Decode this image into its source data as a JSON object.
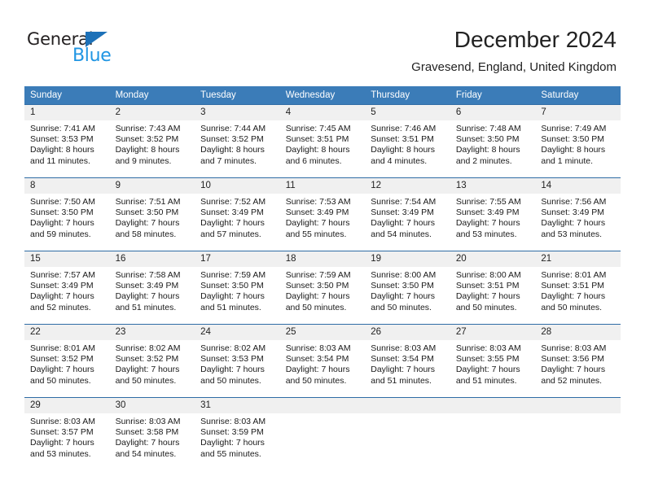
{
  "brand": {
    "name_top": "General",
    "name_bottom": "Blue",
    "accent_color": "#2196e3",
    "triangle_color": "#1d71b8"
  },
  "header": {
    "title": "December 2024",
    "subtitle": "Gravesend, England, United Kingdom"
  },
  "theme": {
    "header_bg": "#3b7cb8",
    "header_text": "#ffffff",
    "row_divider": "#2f6ca5",
    "daynum_bg": "#f0f0f0"
  },
  "weekdays": [
    "Sunday",
    "Monday",
    "Tuesday",
    "Wednesday",
    "Thursday",
    "Friday",
    "Saturday"
  ],
  "weeks": [
    [
      {
        "day": "1",
        "sunrise": "Sunrise: 7:41 AM",
        "sunset": "Sunset: 3:53 PM",
        "daylight1": "Daylight: 8 hours",
        "daylight2": "and 11 minutes."
      },
      {
        "day": "2",
        "sunrise": "Sunrise: 7:43 AM",
        "sunset": "Sunset: 3:52 PM",
        "daylight1": "Daylight: 8 hours",
        "daylight2": "and 9 minutes."
      },
      {
        "day": "3",
        "sunrise": "Sunrise: 7:44 AM",
        "sunset": "Sunset: 3:52 PM",
        "daylight1": "Daylight: 8 hours",
        "daylight2": "and 7 minutes."
      },
      {
        "day": "4",
        "sunrise": "Sunrise: 7:45 AM",
        "sunset": "Sunset: 3:51 PM",
        "daylight1": "Daylight: 8 hours",
        "daylight2": "and 6 minutes."
      },
      {
        "day": "5",
        "sunrise": "Sunrise: 7:46 AM",
        "sunset": "Sunset: 3:51 PM",
        "daylight1": "Daylight: 8 hours",
        "daylight2": "and 4 minutes."
      },
      {
        "day": "6",
        "sunrise": "Sunrise: 7:48 AM",
        "sunset": "Sunset: 3:50 PM",
        "daylight1": "Daylight: 8 hours",
        "daylight2": "and 2 minutes."
      },
      {
        "day": "7",
        "sunrise": "Sunrise: 7:49 AM",
        "sunset": "Sunset: 3:50 PM",
        "daylight1": "Daylight: 8 hours",
        "daylight2": "and 1 minute."
      }
    ],
    [
      {
        "day": "8",
        "sunrise": "Sunrise: 7:50 AM",
        "sunset": "Sunset: 3:50 PM",
        "daylight1": "Daylight: 7 hours",
        "daylight2": "and 59 minutes."
      },
      {
        "day": "9",
        "sunrise": "Sunrise: 7:51 AM",
        "sunset": "Sunset: 3:50 PM",
        "daylight1": "Daylight: 7 hours",
        "daylight2": "and 58 minutes."
      },
      {
        "day": "10",
        "sunrise": "Sunrise: 7:52 AM",
        "sunset": "Sunset: 3:49 PM",
        "daylight1": "Daylight: 7 hours",
        "daylight2": "and 57 minutes."
      },
      {
        "day": "11",
        "sunrise": "Sunrise: 7:53 AM",
        "sunset": "Sunset: 3:49 PM",
        "daylight1": "Daylight: 7 hours",
        "daylight2": "and 55 minutes."
      },
      {
        "day": "12",
        "sunrise": "Sunrise: 7:54 AM",
        "sunset": "Sunset: 3:49 PM",
        "daylight1": "Daylight: 7 hours",
        "daylight2": "and 54 minutes."
      },
      {
        "day": "13",
        "sunrise": "Sunrise: 7:55 AM",
        "sunset": "Sunset: 3:49 PM",
        "daylight1": "Daylight: 7 hours",
        "daylight2": "and 53 minutes."
      },
      {
        "day": "14",
        "sunrise": "Sunrise: 7:56 AM",
        "sunset": "Sunset: 3:49 PM",
        "daylight1": "Daylight: 7 hours",
        "daylight2": "and 53 minutes."
      }
    ],
    [
      {
        "day": "15",
        "sunrise": "Sunrise: 7:57 AM",
        "sunset": "Sunset: 3:49 PM",
        "daylight1": "Daylight: 7 hours",
        "daylight2": "and 52 minutes."
      },
      {
        "day": "16",
        "sunrise": "Sunrise: 7:58 AM",
        "sunset": "Sunset: 3:49 PM",
        "daylight1": "Daylight: 7 hours",
        "daylight2": "and 51 minutes."
      },
      {
        "day": "17",
        "sunrise": "Sunrise: 7:59 AM",
        "sunset": "Sunset: 3:50 PM",
        "daylight1": "Daylight: 7 hours",
        "daylight2": "and 51 minutes."
      },
      {
        "day": "18",
        "sunrise": "Sunrise: 7:59 AM",
        "sunset": "Sunset: 3:50 PM",
        "daylight1": "Daylight: 7 hours",
        "daylight2": "and 50 minutes."
      },
      {
        "day": "19",
        "sunrise": "Sunrise: 8:00 AM",
        "sunset": "Sunset: 3:50 PM",
        "daylight1": "Daylight: 7 hours",
        "daylight2": "and 50 minutes."
      },
      {
        "day": "20",
        "sunrise": "Sunrise: 8:00 AM",
        "sunset": "Sunset: 3:51 PM",
        "daylight1": "Daylight: 7 hours",
        "daylight2": "and 50 minutes."
      },
      {
        "day": "21",
        "sunrise": "Sunrise: 8:01 AM",
        "sunset": "Sunset: 3:51 PM",
        "daylight1": "Daylight: 7 hours",
        "daylight2": "and 50 minutes."
      }
    ],
    [
      {
        "day": "22",
        "sunrise": "Sunrise: 8:01 AM",
        "sunset": "Sunset: 3:52 PM",
        "daylight1": "Daylight: 7 hours",
        "daylight2": "and 50 minutes."
      },
      {
        "day": "23",
        "sunrise": "Sunrise: 8:02 AM",
        "sunset": "Sunset: 3:52 PM",
        "daylight1": "Daylight: 7 hours",
        "daylight2": "and 50 minutes."
      },
      {
        "day": "24",
        "sunrise": "Sunrise: 8:02 AM",
        "sunset": "Sunset: 3:53 PM",
        "daylight1": "Daylight: 7 hours",
        "daylight2": "and 50 minutes."
      },
      {
        "day": "25",
        "sunrise": "Sunrise: 8:03 AM",
        "sunset": "Sunset: 3:54 PM",
        "daylight1": "Daylight: 7 hours",
        "daylight2": "and 50 minutes."
      },
      {
        "day": "26",
        "sunrise": "Sunrise: 8:03 AM",
        "sunset": "Sunset: 3:54 PM",
        "daylight1": "Daylight: 7 hours",
        "daylight2": "and 51 minutes."
      },
      {
        "day": "27",
        "sunrise": "Sunrise: 8:03 AM",
        "sunset": "Sunset: 3:55 PM",
        "daylight1": "Daylight: 7 hours",
        "daylight2": "and 51 minutes."
      },
      {
        "day": "28",
        "sunrise": "Sunrise: 8:03 AM",
        "sunset": "Sunset: 3:56 PM",
        "daylight1": "Daylight: 7 hours",
        "daylight2": "and 52 minutes."
      }
    ],
    [
      {
        "day": "29",
        "sunrise": "Sunrise: 8:03 AM",
        "sunset": "Sunset: 3:57 PM",
        "daylight1": "Daylight: 7 hours",
        "daylight2": "and 53 minutes."
      },
      {
        "day": "30",
        "sunrise": "Sunrise: 8:03 AM",
        "sunset": "Sunset: 3:58 PM",
        "daylight1": "Daylight: 7 hours",
        "daylight2": "and 54 minutes."
      },
      {
        "day": "31",
        "sunrise": "Sunrise: 8:03 AM",
        "sunset": "Sunset: 3:59 PM",
        "daylight1": "Daylight: 7 hours",
        "daylight2": "and 55 minutes."
      },
      {
        "day": "",
        "sunrise": "",
        "sunset": "",
        "daylight1": "",
        "daylight2": ""
      },
      {
        "day": "",
        "sunrise": "",
        "sunset": "",
        "daylight1": "",
        "daylight2": ""
      },
      {
        "day": "",
        "sunrise": "",
        "sunset": "",
        "daylight1": "",
        "daylight2": ""
      },
      {
        "day": "",
        "sunrise": "",
        "sunset": "",
        "daylight1": "",
        "daylight2": ""
      }
    ]
  ]
}
